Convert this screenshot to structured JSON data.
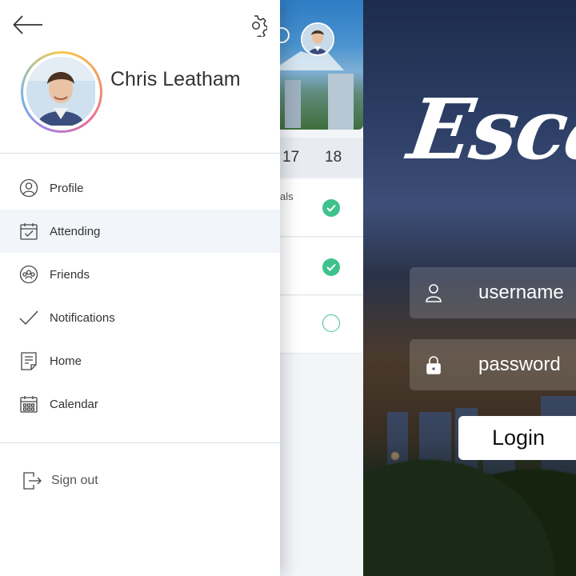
{
  "drawer": {
    "user_name": "Chris Leatham",
    "menu": [
      {
        "label": "Profile",
        "icon": "profile-icon"
      },
      {
        "label": "Attending",
        "icon": "calendar-check-icon",
        "active": true
      },
      {
        "label": "Friends",
        "icon": "friends-icon"
      },
      {
        "label": "Notifications",
        "icon": "checkmark-icon"
      },
      {
        "label": "Home",
        "icon": "home-document-icon"
      },
      {
        "label": "Calendar",
        "icon": "calendar-grid-icon"
      }
    ],
    "sign_out_label": "Sign out"
  },
  "attendance": {
    "day_a": "17",
    "day_b": "18",
    "row_text": "als",
    "rows": [
      {
        "status": "attending"
      },
      {
        "status": "attending"
      },
      {
        "status": "not-attending"
      }
    ]
  },
  "login": {
    "brand_text": "Escap",
    "username_placeholder": "username",
    "password_placeholder": "password",
    "login_label": "Login"
  },
  "colors": {
    "accent_green": "#3ec28d",
    "active_item_bg": "#f2f5f9"
  }
}
